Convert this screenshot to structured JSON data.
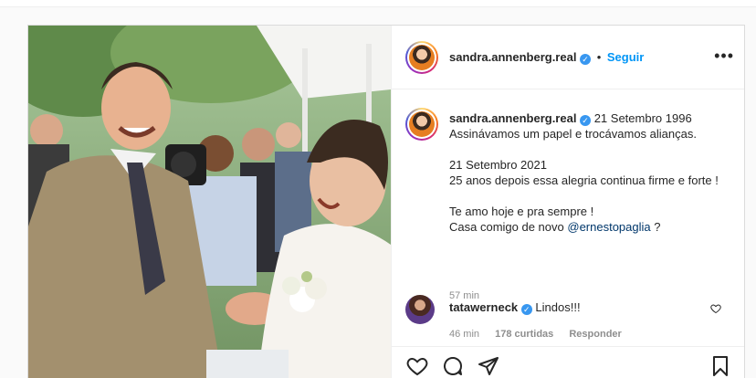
{
  "post": {
    "author": {
      "username": "sandra.annenberg.real",
      "verified_icon": "verified-badge-icon",
      "follow_label": "Seguir",
      "dot": "•"
    },
    "caption": {
      "username": "sandra.annenberg.real",
      "date_inline": "21 Setembro 1996",
      "line1": "Assinávamos um papel e trocávamos alianças.",
      "date2": "21 Setembro 2021",
      "line2": "25 anos depois essa alegria continua firme e forte !",
      "line3": "Te amo hoje e pra sempre !",
      "line4_prefix": "Casa comigo de novo",
      "mention": "@ernestopaglia",
      "line4_suffix": "?",
      "time_ago": "57 min"
    },
    "comment": {
      "username": "tatawerneck",
      "text": "Lindos!!!",
      "time": "46 min",
      "likes": "178 curtidas",
      "reply_label": "Responder"
    },
    "icons": {
      "more": "more-options-icon",
      "like": "heart-icon",
      "comment": "comment-icon",
      "share": "share-icon",
      "save": "bookmark-icon"
    },
    "colors": {
      "link_blue": "#0095f6",
      "verified_blue": "#3897f0",
      "mention": "#00376b",
      "muted": "#8e8e8e"
    }
  }
}
